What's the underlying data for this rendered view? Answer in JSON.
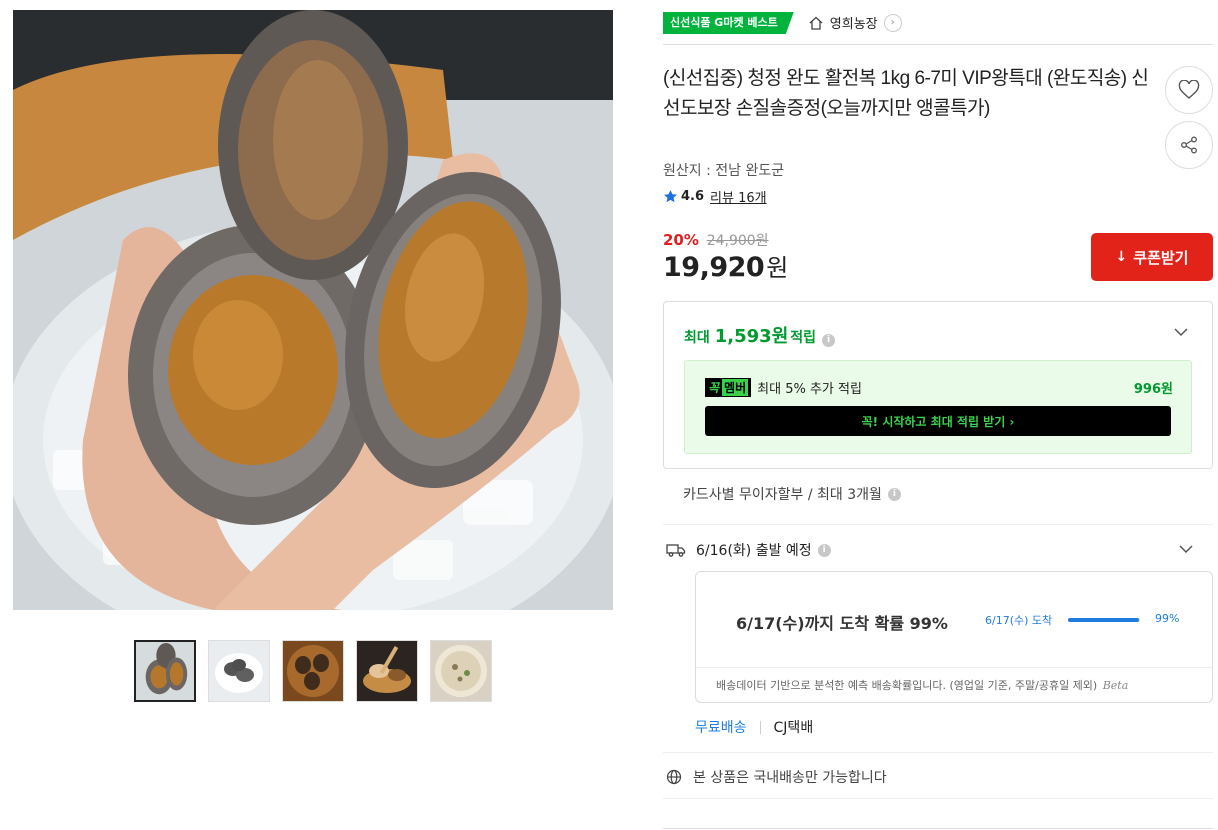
{
  "gallery": {
    "main_image_alt": "abalone-in-hand-photo",
    "thumbnails": [
      {
        "name": "thumb-abalone-hand",
        "active": true
      },
      {
        "name": "thumb-abalone-ice",
        "active": false
      },
      {
        "name": "thumb-abalone-plate",
        "active": false
      },
      {
        "name": "thumb-abalone-dish",
        "active": false
      },
      {
        "name": "thumb-abalone-porridge",
        "active": false
      }
    ]
  },
  "header": {
    "best_badge": "신선식품 G마켓 베스트",
    "seller_name": "영희농장",
    "seller_icon": "home-icon",
    "seller_chevron": "›"
  },
  "product": {
    "title": "(신선집중) 청정 완도 활전복 1kg 6-7미 VIP왕특대 (완도직송) 신선도보장 손질솔증정(오늘까지만 앵콜특가)",
    "origin": "원산지 : 전남 완도군",
    "rating": "4.6",
    "reviews": "리뷰 16개",
    "discount": "20%",
    "original_price": "24,900원",
    "price": "19,920",
    "price_unit": "원",
    "coupon_label": "쿠폰받기",
    "coupon_icon": "↓"
  },
  "points": {
    "prefix": "최대",
    "amount": "1,593원",
    "suffix": "적립",
    "info": "i",
    "member_badge_a": "꼭",
    "member_badge_b": "멤버",
    "member_desc": "최대 5% 추가 적립",
    "member_amount": "996원",
    "member_cta": "꼭! 시작하고 최대 적립 받기  ›"
  },
  "installment": {
    "text": "카드사별 무이자할부 / 최대 3개월",
    "info": "i"
  },
  "shipping": {
    "departure": "6/16(화) 출발 예정",
    "info": "i",
    "main_text": "6/17(수)까지 도착 확률 99%",
    "bar_label": "6/17(수) 도착",
    "bar_value": 0.99,
    "bar_pct": "99%",
    "note": "배송데이터 기반으로 분석한 예측 배송확률입니다. (영업일 기준, 주말/공휴일 제외)",
    "beta": "Beta",
    "free": "무료배송",
    "carrier": "CJ택배",
    "domestic": "본 상품은 국내배송만 가능합니다"
  },
  "colors": {
    "accent_red": "#e2231a",
    "green": "#009a2f",
    "blue": "#1f7de0"
  }
}
